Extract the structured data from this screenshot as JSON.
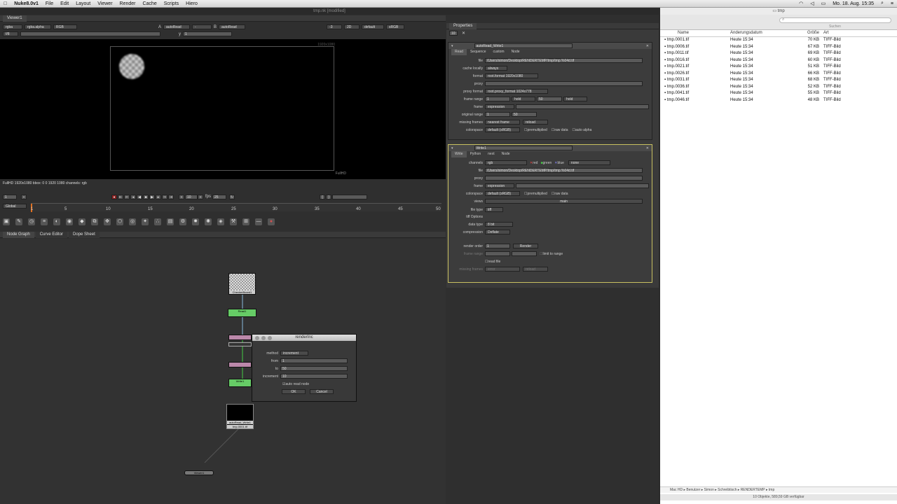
{
  "menubar": {
    "app": "Nuke8.0v1",
    "items": [
      "File",
      "Edit",
      "Layout",
      "Viewer",
      "Render",
      "Cache",
      "Scripts",
      "Hiero"
    ],
    "date": "Mo. 18. Aug. 15:35"
  },
  "window": {
    "title": "tmp.nk [modified]"
  },
  "viewer": {
    "tab": "Viewer1",
    "channels": "rgba",
    "alpha": "rgba.alpha",
    "mode": "RGB",
    "a_input": "A",
    "a_node": "autoRead",
    "b_input": "B",
    "b_node": "autoRead",
    "gain": "-3",
    "view2d": "2D",
    "lut": "default",
    "colorspace": "sRGB",
    "frame": "f/8",
    "y_label": "y",
    "y_value": "1",
    "res_label": "1920x1080",
    "format_label": "FullHD",
    "info": "FullHD 1920x1080 bbox: 0 0 1920 1080 channels: rgb"
  },
  "timeline": {
    "current": "1",
    "end": "10",
    "fps_label": "fps",
    "fps": "25",
    "scope": "Global",
    "ticks": [
      "1",
      "5",
      "10",
      "15",
      "20",
      "25",
      "30",
      "35",
      "40",
      "45",
      "50"
    ]
  },
  "node_tabs": [
    "Node Graph",
    "Curve Editor",
    "Dope Sheet"
  ],
  "nodes": {
    "checker": "CheckerBoard1",
    "read": "Read1",
    "write": "Write1",
    "autoread": "autoRead_Write1",
    "autoread_sub": "tmp.0001.tif",
    "viewer": "Viewer1"
  },
  "dialog": {
    "title": "renderInc",
    "method_label": "method",
    "method": "increment",
    "from_label": "from",
    "from": "1",
    "to_label": "to",
    "to": "50",
    "increment_label": "increment",
    "increment": "10",
    "auto_label": "auto read node",
    "ok": "OK",
    "cancel": "Cancel"
  },
  "properties": {
    "title": "Properties",
    "count": "10",
    "read": {
      "name": "autoRead_Write1",
      "tabs": [
        "Read",
        "Sequence",
        "custom",
        "Node"
      ],
      "file": "/Users/simon/Desktop/RENDERTEMP/tmp/tmp.%04d.tif",
      "cache": "always",
      "format": "root.format 1920x1080",
      "proxy_format": "root.proxy_format 1024x778",
      "range_start": "1",
      "range_end": "50",
      "hold": "hold",
      "frame": "expression",
      "orig_start": "1",
      "orig_end": "50",
      "missing": "nearest frame",
      "reload": "reload",
      "colorspace": "default (sRGB)",
      "premult": "premultiplied",
      "raw": "raw data",
      "auto_alpha": "auto alpha",
      "labels": {
        "file": "file",
        "cache": "cache locally",
        "format": "format",
        "proxy": "proxy",
        "proxy_format": "proxy format",
        "frame_range": "frame range",
        "frame": "frame",
        "original_range": "original range",
        "missing": "missing frames",
        "colorspace": "colorspace"
      }
    },
    "write": {
      "name": "Write1",
      "tabs": [
        "Write",
        "Python",
        "next",
        "Node"
      ],
      "channels": "rgb",
      "red": "red",
      "green": "green",
      "blue": "blue",
      "none": "none",
      "file": "/Users/simon/Desktop/RENDERTEMP/tmp/tmp.%04d.tif",
      "frame": "expression",
      "colorspace": "default (sRGB)",
      "premult": "premultiplied",
      "raw": "raw data",
      "views": "main",
      "file_type": "tiff",
      "tiff_options": "tiff Options",
      "data_type": "8 bit",
      "compression": "Deflate",
      "render_order": "1",
      "render": "Render",
      "limit": "limit to range",
      "read_file": "read file",
      "missing": "error",
      "reload": "reload",
      "labels": {
        "channels": "channels",
        "file": "file",
        "proxy": "proxy",
        "frame": "frame",
        "colorspace": "colorspace",
        "views": "views",
        "file_type": "file type",
        "data_type": "data type",
        "compression": "compression",
        "render_order": "render order",
        "frame_range": "frame range",
        "missing": "missing frames"
      }
    }
  },
  "finder": {
    "folder": "tmp",
    "search": "Suchen",
    "headers": [
      "Name",
      "Änderungsdatum",
      "Größe",
      "Art"
    ],
    "rows": [
      [
        "tmp.0001.tif",
        "Heute 15:34",
        "70 KB",
        "TIFF-Bild"
      ],
      [
        "tmp.0006.tif",
        "Heute 15:34",
        "67 KB",
        "TIFF-Bild"
      ],
      [
        "tmp.0011.tif",
        "Heute 15:34",
        "69 KB",
        "TIFF-Bild"
      ],
      [
        "tmp.0016.tif",
        "Heute 15:34",
        "60 KB",
        "TIFF-Bild"
      ],
      [
        "tmp.0021.tif",
        "Heute 15:34",
        "51 KB",
        "TIFF-Bild"
      ],
      [
        "tmp.0026.tif",
        "Heute 15:34",
        "66 KB",
        "TIFF-Bild"
      ],
      [
        "tmp.0031.tif",
        "Heute 15:34",
        "68 KB",
        "TIFF-Bild"
      ],
      [
        "tmp.0036.tif",
        "Heute 15:34",
        "52 KB",
        "TIFF-Bild"
      ],
      [
        "tmp.0041.tif",
        "Heute 15:34",
        "55 KB",
        "TIFF-Bild"
      ],
      [
        "tmp.0046.tif",
        "Heute 15:34",
        "48 KB",
        "TIFF-Bild"
      ]
    ],
    "path": [
      "Mac HD",
      "Benutzer",
      "Simon",
      "Schreibtisch",
      "RENDERTEMP",
      "tmp"
    ],
    "status": "10 Objekte, 589,59 GB verfügbar"
  }
}
